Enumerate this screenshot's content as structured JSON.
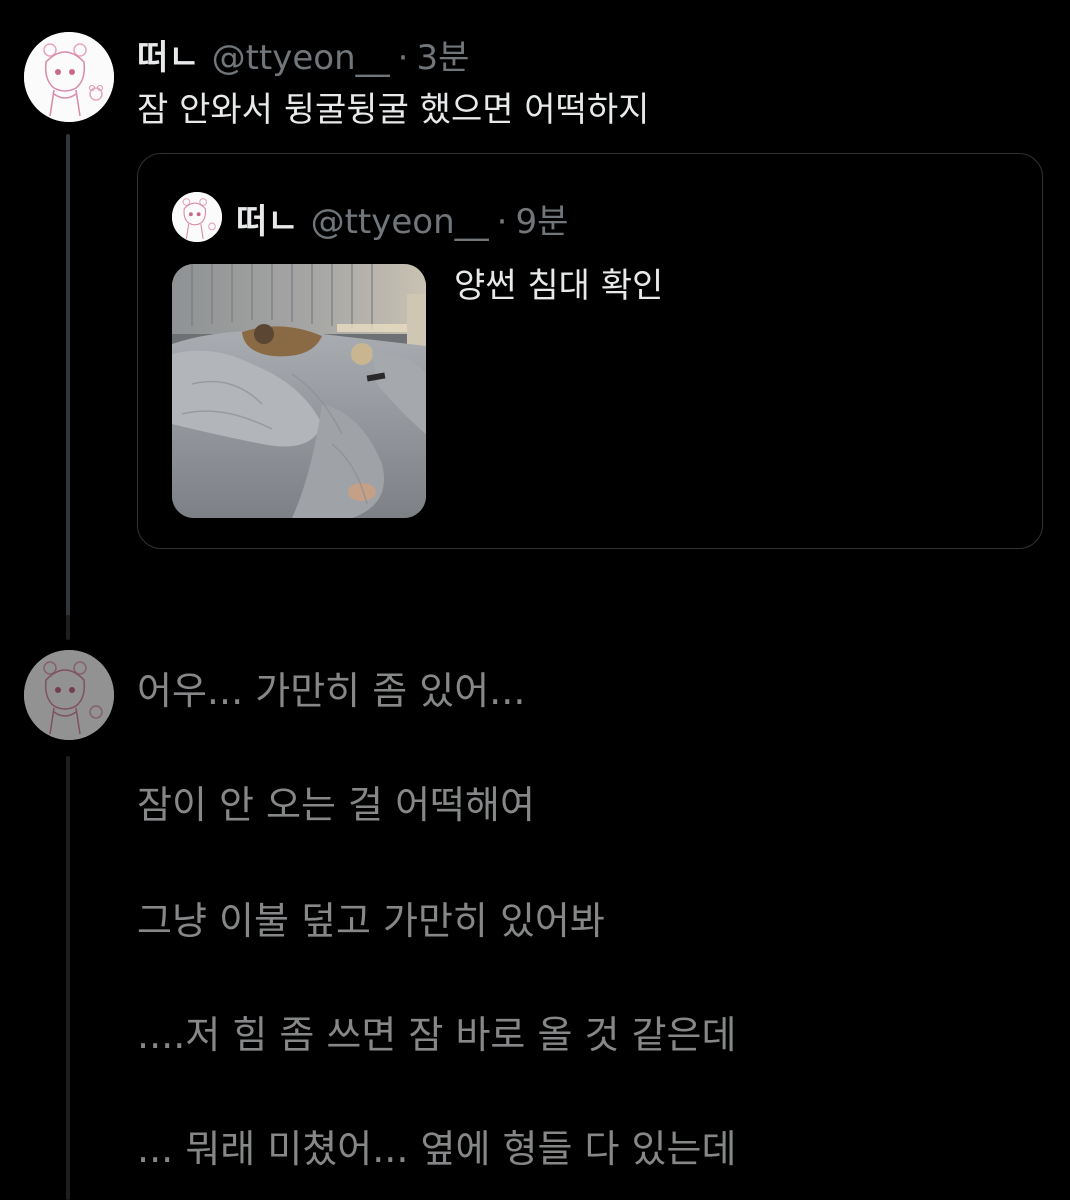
{
  "tweet": {
    "display_name": "떠ㄴ",
    "handle": "@ttyeon__",
    "dot": "·",
    "time": "3분",
    "text": "잠 안와서 뒹굴뒹굴 했으면 어떡하지"
  },
  "quote": {
    "display_name": "떠ㄴ",
    "handle": "@ttyeon__",
    "dot": "·",
    "time": "9분",
    "text": "양썬 침대 확인",
    "image_subject": "bed-photo"
  },
  "reply": {
    "lines": [
      "어우... 가만히 좀 있어...",
      "잠이 안 오는 걸 어떡해여",
      "그냥 이불 덮고 가만히 있어봐",
      "....저 힘 좀 쓰면 잠 바로 올 것 같은데",
      "... 뭐래 미쳤어... 옆에 형들 다 있는데"
    ]
  },
  "colors": {
    "background": "#000000",
    "text": "#e7e9ea",
    "secondary": "#71767b",
    "border": "#2f3336"
  }
}
